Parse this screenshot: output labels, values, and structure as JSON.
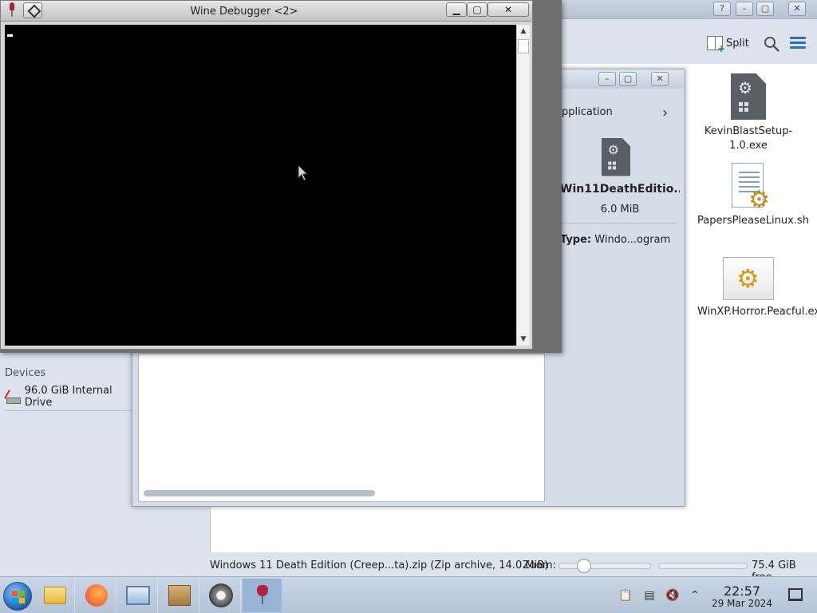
{
  "wine_debugger": {
    "title": "Wine Debugger <2>",
    "minimize_label": "▁",
    "maximize_label": "▢",
    "close_label": "✕"
  },
  "dolphin": {
    "toolbar": {
      "split_label": "Split"
    },
    "files": [
      {
        "name": "KevinBlastSetup-1.0.exe",
        "icon": "exe-icon"
      },
      {
        "name": "PapersPleaseLinux.sh",
        "icon": "script-icon"
      },
      {
        "name": "WinXP.Horror.Peacful.exe",
        "icon": "wine-exe-icon"
      }
    ],
    "sidebar": {
      "devices_heading": "Devices",
      "drive_label": "96.0 GiB Internal Drive"
    },
    "statusbar": {
      "status_text": "Windows 11 Death Edition (Creep...ta).zip (Zip archive, 14.0 MiB)",
      "zoom_label": "Zoom:",
      "free_space": "75.4 GiB free"
    }
  },
  "ark": {
    "info": {
      "type_heading": "pplication",
      "filename": "Win11DeathEditio...",
      "size": "6.0 MiB",
      "type_key": "Type:",
      "type_value": "Windo...ogram"
    }
  },
  "taskbar": {
    "apps": [
      {
        "name": "file-manager",
        "icon": "folder-icon"
      },
      {
        "name": "firefox",
        "icon": "firefox-icon"
      },
      {
        "name": "system-settings",
        "icon": "monitor-icon"
      },
      {
        "name": "archive-manager",
        "icon": "box-icon"
      },
      {
        "name": "system-monitor",
        "icon": "gauge-icon"
      },
      {
        "name": "wine",
        "icon": "wine-icon"
      }
    ],
    "clock": {
      "time": "22:57",
      "date": "29 Mar 2024"
    }
  },
  "colors": {
    "desktop_bg": "#c4d0de",
    "taskbar_bg": "#b4c3d6",
    "console_bg": "#000000",
    "accent": "#2d6fb3"
  }
}
